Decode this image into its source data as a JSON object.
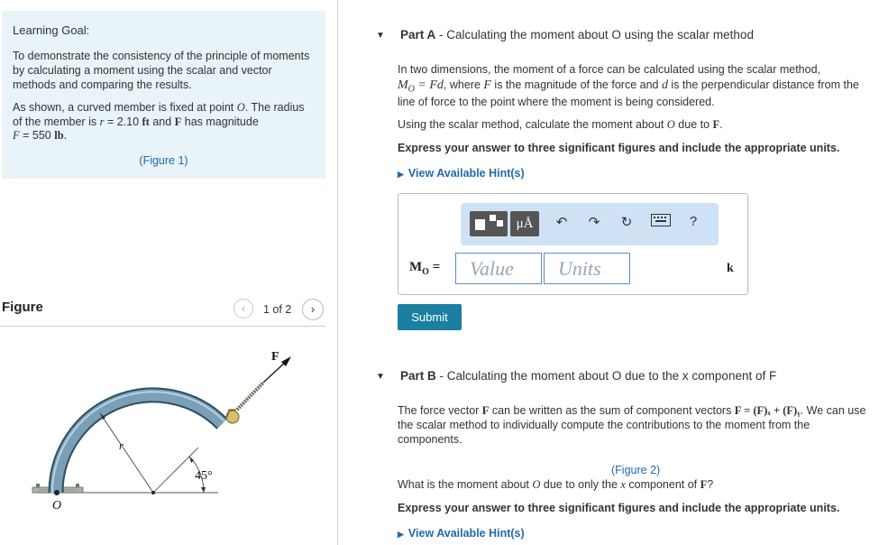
{
  "learning_goal": {
    "title": "Learning Goal:",
    "paragraph1": "To demonstrate the consistency of the principle of moments by calculating a moment using the scalar and vector methods and comparing the results.",
    "paragraph2_a": "As shown, a curved member is fixed at point ",
    "point_O": "O",
    "paragraph2_b": ". The radius of the member is ",
    "r_symbol": "r",
    "r_value": " = 2.10 ",
    "r_unit": "ft",
    "and_text": " and ",
    "F_symbol": "F",
    "has_magnitude": " has magnitude",
    "F_italic": "F",
    "F_value": " = 550 ",
    "F_unit": "lb",
    "period": ".",
    "figure_link": "(Figure 1)"
  },
  "figure_panel": {
    "title": "Figure",
    "prev_icon": "‹",
    "count": "1 of 2",
    "next_icon": "›",
    "labels": {
      "force": "F",
      "radius": "r",
      "angle": "45°",
      "origin": "O"
    }
  },
  "part_a": {
    "label": "Part A",
    "title": " - Calculating the moment about O using the scalar method",
    "intro_1": "In two dimensions, the moment of a force can be calculated using the scalar method,",
    "intro_formula": "M",
    "intro_formula_sub": "O",
    "intro_formula_rest": " = Fd",
    "intro_2": ", where ",
    "intro_F": "F",
    "intro_3": " is the magnitude of the force and ",
    "intro_d": "d",
    "intro_4": " is the perpendicular distance from the line of force to the point where the moment is being considered.",
    "instruction_a": "Using the scalar method, calculate the moment about ",
    "instruction_O": "O",
    "instruction_b": " due to ",
    "instruction_F": "F",
    "instruction_c": ".",
    "express": "Express your answer to three significant figures and include the appropriate units.",
    "hints": "View Available Hint(s)",
    "answer": {
      "label_M": "M",
      "label_sub": "O",
      "label_eq": " =",
      "value_placeholder": "Value",
      "units_placeholder": "Units",
      "vector": "k",
      "units_button": "μÅ",
      "help": "?"
    },
    "submit": "Submit"
  },
  "part_b": {
    "label": "Part B",
    "title": " - Calculating the moment about O due to the x component of F",
    "text_1": "The force vector ",
    "text_F": "F",
    "text_2": " can be written as the sum of component vectors ",
    "text_formula": "F = (F)ₓ + (F)ᵧ",
    "text_3": ". We can use the scalar method to individually compute the contributions to the moment from the components.",
    "figure_link": "(Figure 2)",
    "question_a": "What is the moment about ",
    "question_O": "O",
    "question_b": " due to only the ",
    "question_x": "x",
    "question_c": " component of ",
    "question_F": "F",
    "question_d": "?",
    "express": "Express your answer to three significant figures and include the appropriate units.",
    "hints": "View Available Hint(s)"
  }
}
